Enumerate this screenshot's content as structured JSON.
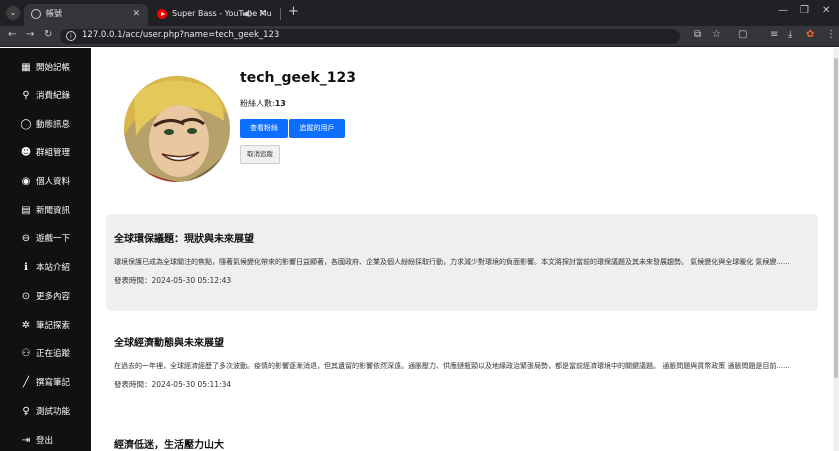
{
  "browser": {
    "tabs": [
      {
        "title": "帳號",
        "active": true
      },
      {
        "title": "Super Bass - YouTube Mu",
        "active": false
      }
    ],
    "url": "127.0.0.1/acc/user.php?name=tech_geek_123"
  },
  "sidebar": {
    "items": [
      {
        "label": "開始記帳",
        "icon": "calculator-icon"
      },
      {
        "label": "消費紀錄",
        "icon": "search-icon"
      },
      {
        "label": "動態訊息",
        "icon": "chat-bubble-icon"
      },
      {
        "label": "群組管理",
        "icon": "group-icon"
      },
      {
        "label": "個人資料",
        "icon": "user-circle-icon"
      },
      {
        "label": "新聞資訊",
        "icon": "newspaper-icon"
      },
      {
        "label": "遊戲一下",
        "icon": "gamepad-icon"
      },
      {
        "label": "本站介紹",
        "icon": "info-icon"
      },
      {
        "label": "更多內容",
        "icon": "more-icon"
      },
      {
        "label": "筆記探索",
        "icon": "explore-icon"
      },
      {
        "label": "正在追蹤",
        "icon": "following-icon"
      },
      {
        "label": "撰寫筆記",
        "icon": "pen-icon"
      },
      {
        "label": "測試功能",
        "icon": "lightbulb-icon"
      },
      {
        "label": "登出",
        "icon": "logout-icon"
      }
    ]
  },
  "profile": {
    "username": "tech_geek_123",
    "followers_label": "粉絲人數:",
    "followers_count": "13",
    "view_followers_button": "查看粉絲",
    "following_button": "追蹤的用戶",
    "unfollow_button": "取消追蹤"
  },
  "posts": [
    {
      "title": "全球環保議題：現狀與未來展望",
      "body": "環境保護已成為全球關注的焦點，隨著氣候變化帶來的影響日益顯著，各國政府、企業及個人紛紛採取行動，力求減少對環境的負面影響。本文將探討當前的環保議題及其未來發展趨勢。 氣候變化與全球暖化 氣候變......",
      "time": "發表時間：2024-05-30 05:12:43"
    },
    {
      "title": "全球經濟動態與未來展望",
      "body": "在過去的一年裡，全球經濟經歷了多次波動。疫情的影響逐漸消退，但其遺留的影響依然深遠。通脹壓力、供應鏈瓶頸以及地緣政治緊張局勢，都是當前經濟環境中的關鍵議題。 通脹問題與貨幣政策 通脹問題是目前......",
      "time": "發表時間：2024-05-30 05:11:34"
    },
    {
      "title": "經濟低迷，生活壓力山大",
      "body": "",
      "time": ""
    }
  ]
}
